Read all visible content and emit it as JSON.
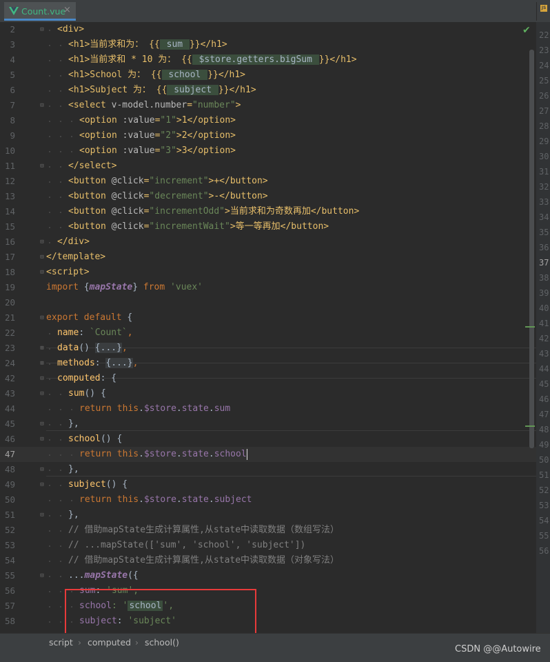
{
  "tab": {
    "name": "Count.vue",
    "close": "×",
    "icon": "vue-icon",
    "accent": "#41b883"
  },
  "second_tab": {
    "icon": "js-file-icon",
    "label": "JS"
  },
  "editor": {
    "current_line": "47",
    "gutter_numbers": [
      "2",
      "3",
      "4",
      "5",
      "6",
      "7",
      "8",
      "9",
      "10",
      "11",
      "12",
      "13",
      "14",
      "15",
      "16",
      "17",
      "18",
      "19",
      "20",
      "21",
      "22",
      "23",
      "24",
      "42",
      "43",
      "44",
      "45",
      "46",
      "47",
      "48",
      "49",
      "50",
      "51",
      "52",
      "53",
      "54",
      "55",
      "56",
      "57",
      "58"
    ],
    "right_gutter_numbers": [
      "22",
      "23",
      "24",
      "25",
      "26",
      "27",
      "28",
      "29",
      "30",
      "31",
      "32",
      "33",
      "34",
      "35",
      "36",
      "37",
      "38",
      "39",
      "40",
      "41",
      "42",
      "43",
      "44",
      "45",
      "46",
      "47",
      "48",
      "49",
      "50",
      "51",
      "52",
      "53",
      "54",
      "55",
      "56"
    ],
    "right_gutter_current": "37",
    "lines": [
      {
        "t": "<div>"
      },
      {
        "a": "<h1>当前求和为： {{",
        "b": " sum ",
        "c": "}}</h1>"
      },
      {
        "a": "<h1>当前求和 * 10 为： {{",
        "b": " $store.getters.bigSum ",
        "c": "}}</h1>"
      },
      {
        "a": "<h1>School 为： {{",
        "b": " school ",
        "c": "}}</h1>"
      },
      {
        "a": "<h1>Subject 为： {{",
        "b": " subject ",
        "c": "}}</h1>"
      },
      {
        "a": "<select ",
        "b": "v-model.number",
        "c": "=",
        "d": "\"number\"",
        "e": ">"
      },
      {
        "a": "<option ",
        "b": ":value",
        "c": "=",
        "d": "\"1\"",
        "e": ">1</option>"
      },
      {
        "a": "<option ",
        "b": ":value",
        "c": "=",
        "d": "\"2\"",
        "e": ">2</option>"
      },
      {
        "a": "<option ",
        "b": ":value",
        "c": "=",
        "d": "\"3\"",
        "e": ">3</option>"
      },
      {
        "t": "</select>"
      },
      {
        "a": "<button ",
        "b": "@click",
        "c": "=",
        "d": "\"increment\"",
        "e": ">+</button>"
      },
      {
        "a": "<button ",
        "b": "@click",
        "c": "=",
        "d": "\"decrement\"",
        "e": ">-</button>"
      },
      {
        "a": "<button ",
        "b": "@click",
        "c": "=",
        "d": "\"incrementOdd\"",
        "e": ">当前求和为奇数再加</button>"
      },
      {
        "a": "<button ",
        "b": "@click",
        "c": "=",
        "d": "\"incrementWait\"",
        "e": ">等一等再加</button>"
      },
      {
        "t": "</div>"
      },
      {
        "t": "</template>"
      },
      {
        "t": "<script>"
      },
      {
        "a": "import ",
        "b": "{",
        "c": "mapState",
        "d": "} ",
        "e": "from ",
        "f": "'vuex'"
      },
      {
        "t": ""
      },
      {
        "a": "export default ",
        "b": "{"
      },
      {
        "a": "name",
        "b": ": ",
        "c": "`Count`",
        "d": ","
      },
      {
        "a": "data",
        "b": "() ",
        "c": "{...}",
        "d": ","
      },
      {
        "a": "methods",
        "b": ": ",
        "c": "{...}",
        "d": ","
      },
      {
        "a": "computed",
        "b": ": {"
      },
      {
        "a": "sum",
        "b": "() {"
      },
      {
        "a": "return ",
        "b": "this",
        "c": ".",
        "d": "$store",
        "e": ".",
        "f": "state",
        "g": ".",
        "h": "sum"
      },
      {
        "t": "},"
      },
      {
        "a": "school",
        "b": "() {"
      },
      {
        "a": "return ",
        "b": "this",
        "c": ".",
        "d": "$store",
        "e": ".",
        "f": "state",
        "g": ".",
        "h": "school"
      },
      {
        "t": "},"
      },
      {
        "a": "subject",
        "b": "() {"
      },
      {
        "a": "return ",
        "b": "this",
        "c": ".",
        "d": "$store",
        "e": ".",
        "f": "state",
        "g": ".",
        "h": "subject"
      },
      {
        "t": "},"
      },
      {
        "t": "// 借助mapState生成计算属性,从state中读取数据（数组写法）"
      },
      {
        "t": "// ...mapState(['sum', 'school', 'subject'])"
      },
      {
        "t": "// 借助mapState生成计算属性,从state中读取数据（对象写法）"
      },
      {
        "a": "...",
        "b": "mapState",
        "c": "({"
      },
      {
        "a": "sum",
        "b": ": ",
        "c": "'sum'",
        "d": ","
      },
      {
        "a": "school",
        "b": ": '",
        "c": "school",
        "d": "',"
      },
      {
        "a": "subject",
        "b": ": ",
        "c": "'subject'"
      }
    ]
  },
  "breadcrumb": [
    "script",
    "computed",
    "school()"
  ],
  "breadcrumb_separator": "›",
  "watermark": "CSDN @@Autowire",
  "status_icon": "checkmark-icon"
}
